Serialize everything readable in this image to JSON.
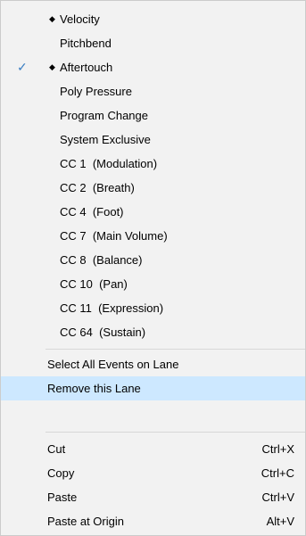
{
  "lanes": [
    {
      "label": "Velocity",
      "bullet": "◆",
      "check": ""
    },
    {
      "label": "Pitchbend",
      "bullet": "",
      "check": ""
    },
    {
      "label": "Aftertouch",
      "bullet": "◆",
      "check": "✓"
    },
    {
      "label": "Poly Pressure",
      "bullet": "",
      "check": ""
    },
    {
      "label": "Program Change",
      "bullet": "",
      "check": ""
    },
    {
      "label": "System Exclusive",
      "bullet": "",
      "check": ""
    },
    {
      "label": "CC 1  (Modulation)",
      "bullet": "",
      "check": ""
    },
    {
      "label": "CC 2  (Breath)",
      "bullet": "",
      "check": ""
    },
    {
      "label": "CC 4  (Foot)",
      "bullet": "",
      "check": ""
    },
    {
      "label": "CC 7  (Main Volume)",
      "bullet": "",
      "check": ""
    },
    {
      "label": "CC 8  (Balance)",
      "bullet": "",
      "check": ""
    },
    {
      "label": "CC 10  (Pan)",
      "bullet": "",
      "check": ""
    },
    {
      "label": "CC 11  (Expression)",
      "bullet": "",
      "check": ""
    },
    {
      "label": "CC 64  (Sustain)",
      "bullet": "",
      "check": ""
    }
  ],
  "lane_actions": {
    "select_all": "Select All Events on Lane",
    "remove_lane": "Remove this Lane"
  },
  "edit": {
    "cut": {
      "label": "Cut",
      "shortcut": "Ctrl+X"
    },
    "copy": {
      "label": "Copy",
      "shortcut": "Ctrl+C"
    },
    "paste": {
      "label": "Paste",
      "shortcut": "Ctrl+V"
    },
    "paste_origin": {
      "label": "Paste at Origin",
      "shortcut": "Alt+V"
    }
  },
  "colors": {
    "menu_bg": "#f2f2f2",
    "highlight": "#cde8ff",
    "check": "#3c7fc3"
  }
}
